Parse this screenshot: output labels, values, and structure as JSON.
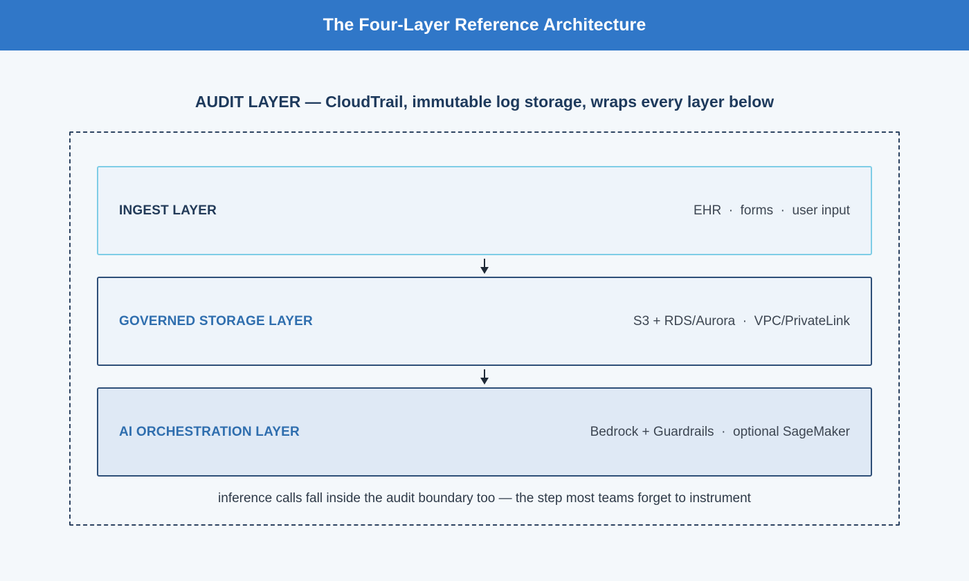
{
  "header": {
    "title": "The Four-Layer Reference Architecture"
  },
  "audit": {
    "title": "AUDIT LAYER — CloudTrail, immutable log storage, wraps every layer below"
  },
  "layers": [
    {
      "name": "INGEST LAYER",
      "description": "EHR  ·  forms  ·  user input"
    },
    {
      "name": "GOVERNED STORAGE LAYER",
      "description": "S3 + RDS/Aurora  ·  VPC/PrivateLink"
    },
    {
      "name": "AI ORCHESTRATION LAYER",
      "description": "Bedrock + Guardrails  ·  optional SageMaker"
    }
  ],
  "footnote": "inference calls fall inside the audit boundary too — the step most teams forget to instrument",
  "colors": {
    "header_bg": "#3077c8",
    "accent_blue": "#2f6eae",
    "ingest_border": "#7ecde6",
    "dark_border": "#2e4f78"
  }
}
